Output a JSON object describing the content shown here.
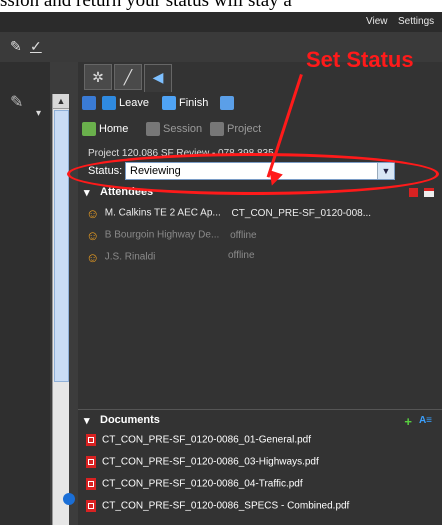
{
  "caption": "ssion and return your status will stay a",
  "menu": {
    "view": "View",
    "settings": "Settings"
  },
  "toolbar": {
    "markup_label": "✓"
  },
  "tabs": [
    {
      "icon": "gear-icon",
      "glyph": "✲"
    },
    {
      "icon": "ruler-icon",
      "glyph": "╱"
    },
    {
      "icon": "megaphone-icon",
      "glyph": "◀"
    }
  ],
  "actions": {
    "leave": "Leave",
    "finish": "Finish"
  },
  "nav": {
    "home": "Home",
    "session": "Session",
    "project": "Project"
  },
  "project_line": "Project 120.086 SF Review - 078 398 835",
  "status": {
    "label": "Status:",
    "value": "Reviewing"
  },
  "attendees": {
    "title": "Attendees",
    "items": [
      {
        "name": "M. Calkins TE 2 AEC Ap...",
        "status": "CT_CON_PRE-SF_0120-008...",
        "active": true
      },
      {
        "name": "B Bourgoin Highway De...",
        "status": "offline",
        "active": false
      },
      {
        "name": "J.S. Rinaldi",
        "status": "offline",
        "active": false
      }
    ]
  },
  "documents": {
    "title": "Documents",
    "items": [
      "CT_CON_PRE-SF_0120-0086_01-General.pdf",
      "CT_CON_PRE-SF_0120-0086_03-Highways.pdf",
      "CT_CON_PRE-SF_0120-0086_04-Traffic.pdf",
      "CT_CON_PRE-SF_0120-0086_SPECS - Combined.pdf"
    ]
  },
  "annotation": {
    "text": "Set Status",
    "color": "#ff1a1a"
  },
  "colors": {
    "panel": "#333333",
    "accent": "#1a6ed6",
    "person": "#f0a020",
    "pdf": "#d82222"
  }
}
